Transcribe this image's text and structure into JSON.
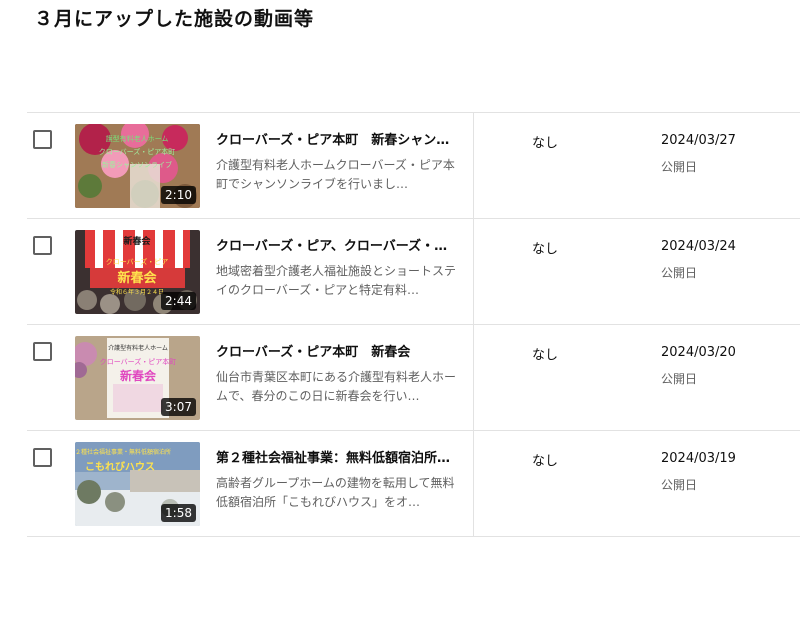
{
  "page": {
    "title": "３月にアップした施設の動画等"
  },
  "videos": [
    {
      "title": "クローバーズ・ピア本町　新春シャン…",
      "description": "介護型有料老人ホームクローバーズ・ピア本町でシャンソンライブを行いまし…",
      "duration": "2:10",
      "restriction": "なし",
      "date": "2024/03/27",
      "date_label": "公開日",
      "thumb_texts": [
        "護型有料老人ホーム",
        "クローバーズ・ピア本町",
        "新春シャンソンライブ"
      ]
    },
    {
      "title": "クローバーズ・ピア、クローバーズ・…",
      "description": "地域密着型介護老人福祉施設とショートステイのクローバーズ・ピアと特定有料…",
      "duration": "2:44",
      "restriction": "なし",
      "date": "2024/03/24",
      "date_label": "公開日",
      "thumb_texts": [
        "新春会",
        "クローバーズ・ピア",
        "新春会",
        "令和６年３月２４日"
      ]
    },
    {
      "title": "クローバーズ・ピア本町　新春会",
      "description": "仙台市青葉区本町にある介護型有料老人ホームで、春分のこの日に新春会を行い…",
      "duration": "3:07",
      "restriction": "なし",
      "date": "2024/03/20",
      "date_label": "公開日",
      "thumb_texts": [
        "介護型有料老人ホーム",
        "クローバーズ・ピア本町",
        "新春会"
      ]
    },
    {
      "title": "第２種社会福祉事業：無料低額宿泊所…",
      "description": "高齢者グループホームの建物を転用して無料低額宿泊所「こもれびハウス」をオ…",
      "duration": "1:58",
      "restriction": "なし",
      "date": "2024/03/19",
      "date_label": "公開日",
      "thumb_texts": [
        "第２種社会福祉事業・無料低額宿泊所",
        "こもれびハウス"
      ]
    }
  ]
}
